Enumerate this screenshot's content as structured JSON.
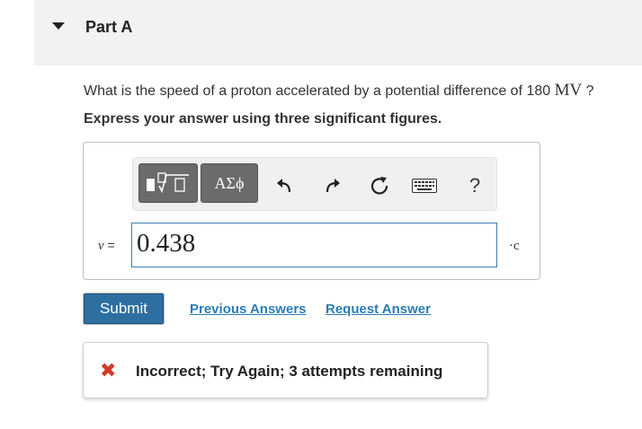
{
  "part": {
    "title": "Part A"
  },
  "question": {
    "text": "What is the speed of a proton accelerated by a potential difference of 180",
    "unit": "MV",
    "end": " ?"
  },
  "instruction": "Express your answer using three significant figures.",
  "toolbar": {
    "symbols_label": "ΑΣϕ",
    "help_label": "?"
  },
  "answer": {
    "variable": "v",
    "equals": " =",
    "value": "0.438",
    "unit": "·c"
  },
  "actions": {
    "submit_label": "Submit",
    "previous_answers_label": "Previous Answers",
    "request_answer_label": "Request Answer"
  },
  "feedback": {
    "icon": "✖",
    "text": "Incorrect; Try Again; 3 attempts remaining",
    "color": "#d23a2a"
  }
}
